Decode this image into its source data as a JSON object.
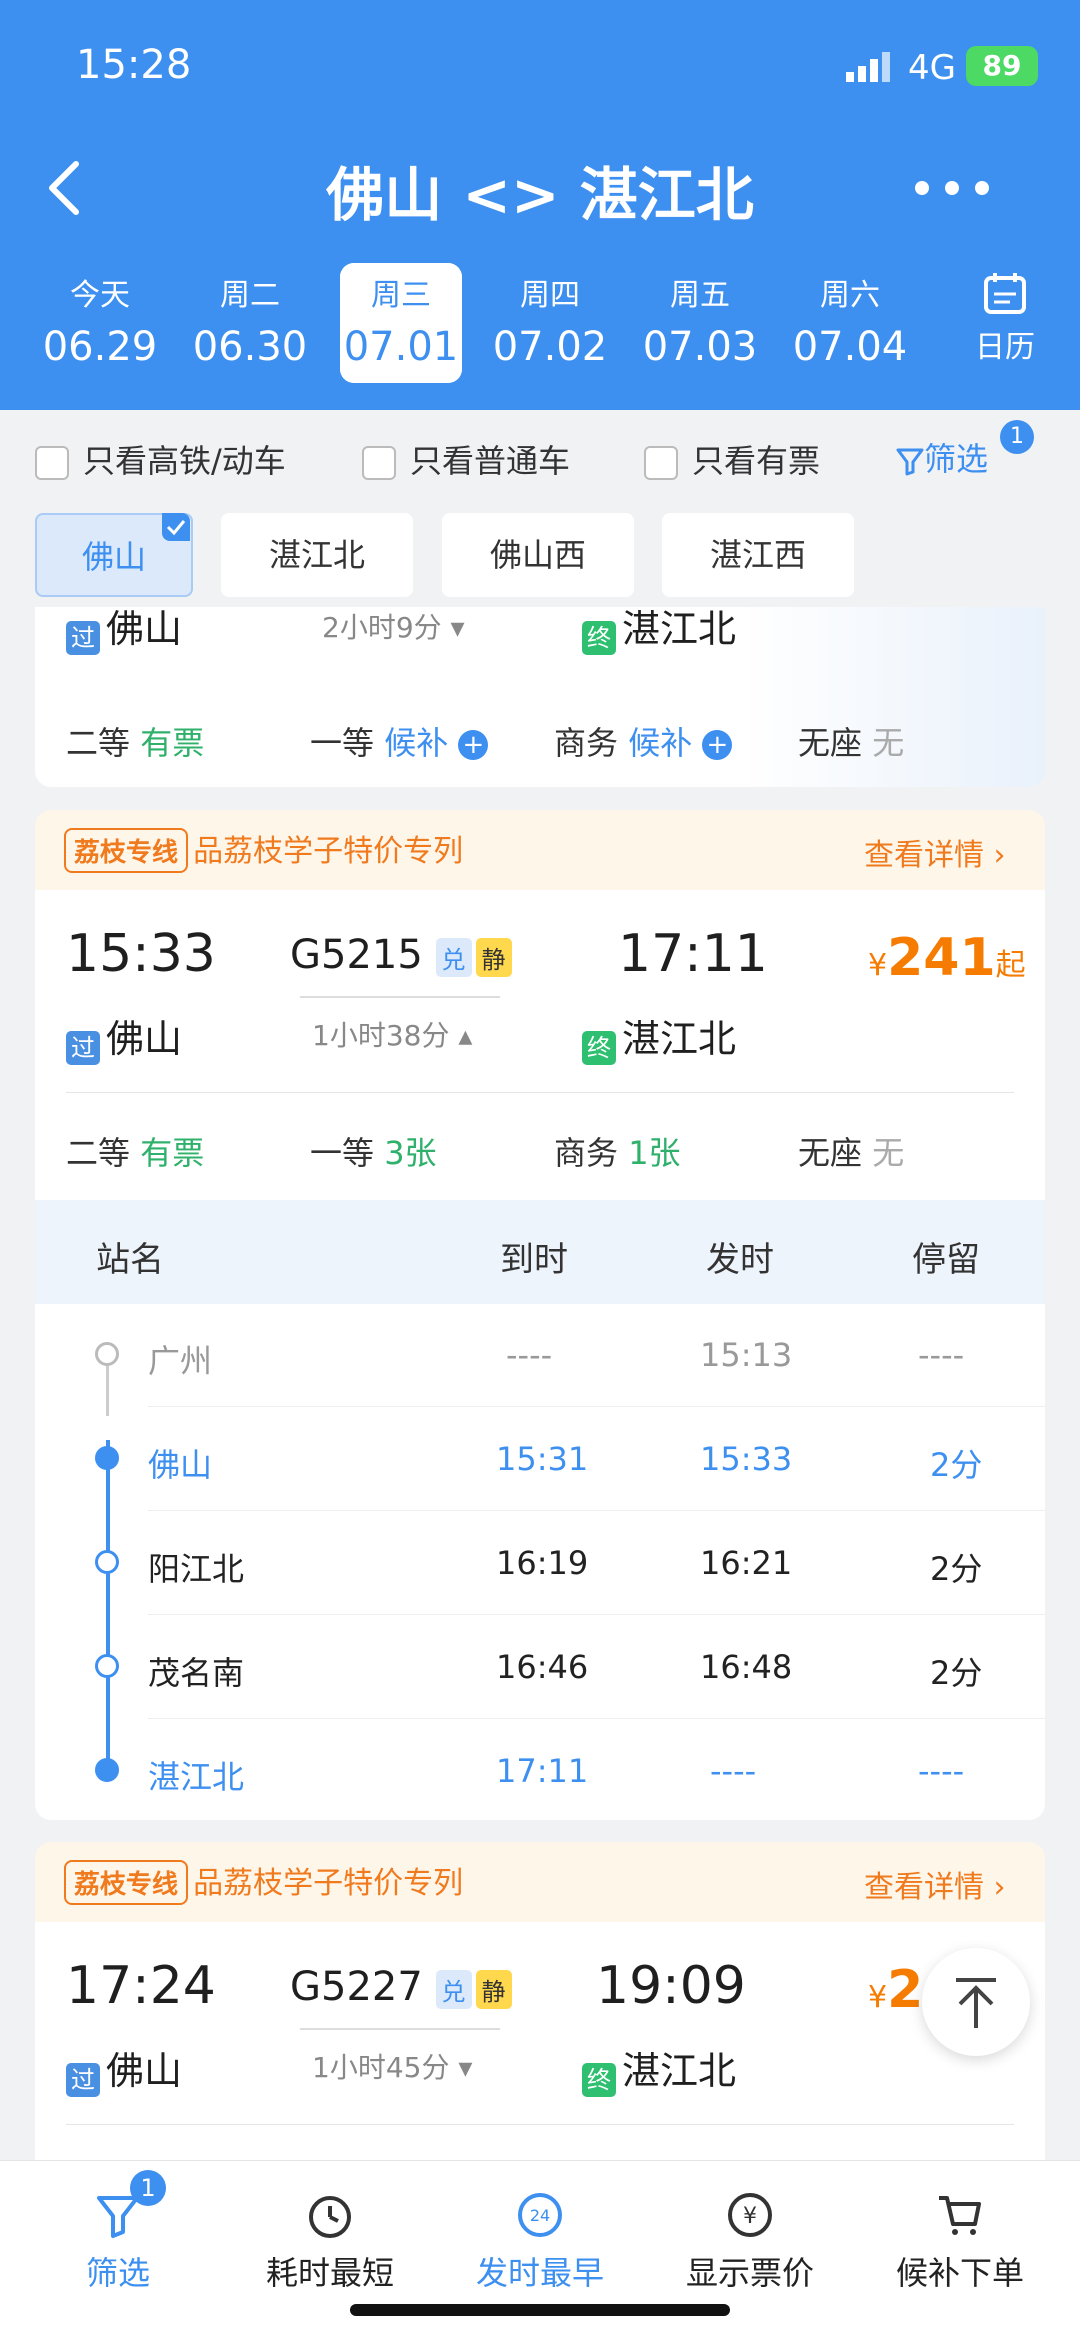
{
  "status_bar": {
    "time": "15:28",
    "network": "4G",
    "battery": "89"
  },
  "header": {
    "title": "佛山 <> 湛江北",
    "back_icon": "chevron-left-icon",
    "more_icon": "more-icon"
  },
  "dates": [
    {
      "weekday": "今天",
      "date": "06.29"
    },
    {
      "weekday": "周二",
      "date": "06.30"
    },
    {
      "weekday": "周三",
      "date": "07.01"
    },
    {
      "weekday": "周四",
      "date": "07.02"
    },
    {
      "weekday": "周五",
      "date": "07.03"
    },
    {
      "weekday": "周六",
      "date": "07.04"
    }
  ],
  "calendar_label": "日历",
  "filters": {
    "high_speed": "只看高铁/动车",
    "normal": "只看普通车",
    "available": "只看有票",
    "filter": "筛选",
    "filter_count": "1"
  },
  "station_tabs": [
    "佛山",
    "湛江北",
    "佛山西",
    "湛江西"
  ],
  "partial_train": {
    "from_badge": "过",
    "from": "佛山",
    "duration": "2小时9分",
    "to_badge": "终",
    "to": "湛江北",
    "seats": [
      {
        "name": "二等",
        "status": "有票"
      },
      {
        "name": "一等",
        "status": "候补"
      },
      {
        "name": "商务",
        "status": "候补"
      },
      {
        "name": "无座",
        "status": "无"
      }
    ]
  },
  "promo": {
    "tag": "荔枝专线",
    "text": "品荔枝学子特价专列",
    "link": "查看详情"
  },
  "train1": {
    "depart": "15:33",
    "number": "G5215",
    "tag1": "兑",
    "tag2": "静",
    "arrive": "17:11",
    "price_symbol": "¥",
    "price": "241",
    "price_suffix": "起",
    "from_badge": "过",
    "from": "佛山",
    "duration": "1小时38分",
    "to_badge": "终",
    "to": "湛江北",
    "seats": [
      {
        "name": "二等",
        "status": "有票"
      },
      {
        "name": "一等",
        "status": "3张"
      },
      {
        "name": "商务",
        "status": "1张"
      },
      {
        "name": "无座",
        "status": "无"
      }
    ]
  },
  "stops_header": {
    "station": "站名",
    "arrive": "到时",
    "depart": "发时",
    "stay": "停留"
  },
  "stops": [
    {
      "station": "广州",
      "arrive": "----",
      "depart": "15:13",
      "stay": "----"
    },
    {
      "station": "佛山",
      "arrive": "15:31",
      "depart": "15:33",
      "stay": "2分"
    },
    {
      "station": "阳江北",
      "arrive": "16:19",
      "depart": "16:21",
      "stay": "2分"
    },
    {
      "station": "茂名南",
      "arrive": "16:46",
      "depart": "16:48",
      "stay": "2分"
    },
    {
      "station": "湛江北",
      "arrive": "17:11",
      "depart": "----",
      "stay": "----"
    }
  ],
  "promo2": {
    "tag": "荔枝专线",
    "text": "品荔枝学子特价专列",
    "link": "查看详情"
  },
  "train2": {
    "depart": "17:24",
    "number": "G5227",
    "tag1": "兑",
    "tag2": "静",
    "arrive": "19:09",
    "price_symbol": "¥",
    "price": "2",
    "from_badge": "过",
    "from": "佛山",
    "duration": "1小时45分",
    "to_badge": "终",
    "to": "湛江北"
  },
  "tabbar": [
    {
      "label": "筛选",
      "badge": "1",
      "icon": "filter-icon"
    },
    {
      "label": "耗时最短",
      "icon": "timer-icon"
    },
    {
      "label": "发时最早",
      "icon": "clock-24-icon"
    },
    {
      "label": "显示票价",
      "icon": "yen-icon"
    },
    {
      "label": "候补下单",
      "icon": "cart-icon"
    }
  ],
  "colors": {
    "primary": "#3d8ff0",
    "green": "#2fb06b",
    "orange": "#f57c00"
  }
}
